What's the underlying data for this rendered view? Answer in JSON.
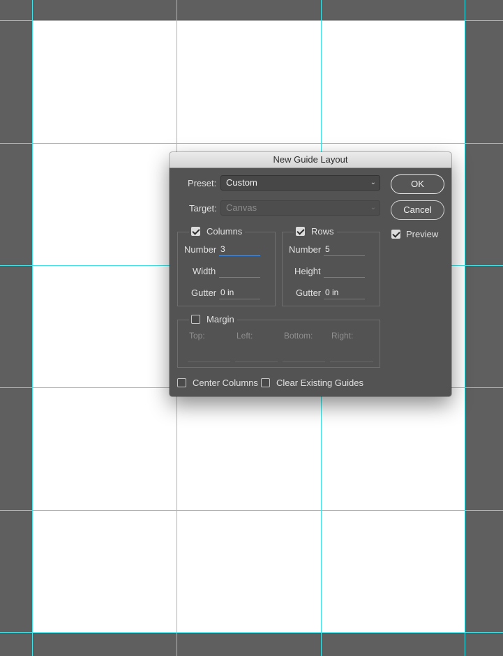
{
  "dialog": {
    "title": "New Guide Layout",
    "preset": {
      "label": "Preset:",
      "value": "Custom"
    },
    "target": {
      "label": "Target:",
      "value": "Canvas"
    },
    "buttons": {
      "ok": "OK",
      "cancel": "Cancel"
    },
    "preview": {
      "label": "Preview",
      "checked": true
    },
    "columns": {
      "label": "Columns",
      "checked": true,
      "number_label": "Number",
      "number_value": "3",
      "width_label": "Width",
      "width_value": "",
      "gutter_label": "Gutter",
      "gutter_value": "0 in"
    },
    "rows": {
      "label": "Rows",
      "checked": true,
      "number_label": "Number",
      "number_value": "5",
      "height_label": "Height",
      "height_value": "",
      "gutter_label": "Gutter",
      "gutter_value": "0 in"
    },
    "margin": {
      "label": "Margin",
      "checked": false,
      "top_label": "Top:",
      "left_label": "Left:",
      "bottom_label": "Bottom:",
      "right_label": "Right:"
    },
    "center_columns": {
      "label": "Center Columns",
      "checked": false
    },
    "clear_guides": {
      "label": "Clear Existing Guides",
      "checked": false
    }
  },
  "colors": {
    "guide": "#3fe2e6",
    "pasteboard": "#5f5f5f",
    "canvas": "#ffffff",
    "dialog_bg": "#535353"
  }
}
